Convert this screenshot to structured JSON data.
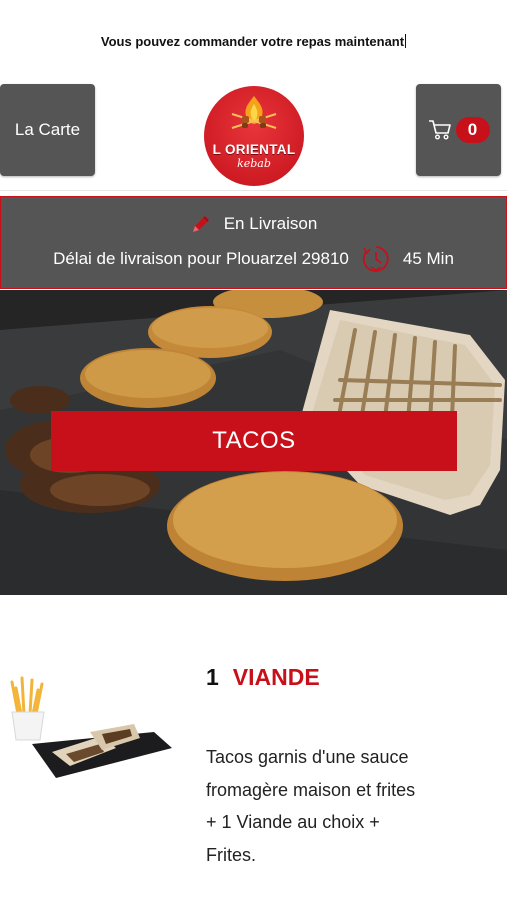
{
  "banner": {
    "text": "Vous pouvez commander votre repas maintenant"
  },
  "header": {
    "menu_button_label": "La Carte",
    "cart_count": "0",
    "logo": {
      "name": "L ORIENTAL",
      "sub": "kebab"
    }
  },
  "delivery": {
    "mode_label": "En Livraison",
    "delay_label": "Délai de livraison pour Plouarzel 29810",
    "delay_value": "45 Min"
  },
  "category": {
    "title": "TACOS"
  },
  "product": {
    "number": "1",
    "name": "VIANDE",
    "description": "Tacos garnis d'une sauce fromagère maison et frites  + 1 Viande au choix + Frites."
  },
  "colors": {
    "accent": "#c8101a",
    "panel": "#555555"
  },
  "icons": {
    "menu": "none",
    "cart": "cart-icon",
    "delivery": "pencil-icon",
    "delay": "clock-icon"
  }
}
